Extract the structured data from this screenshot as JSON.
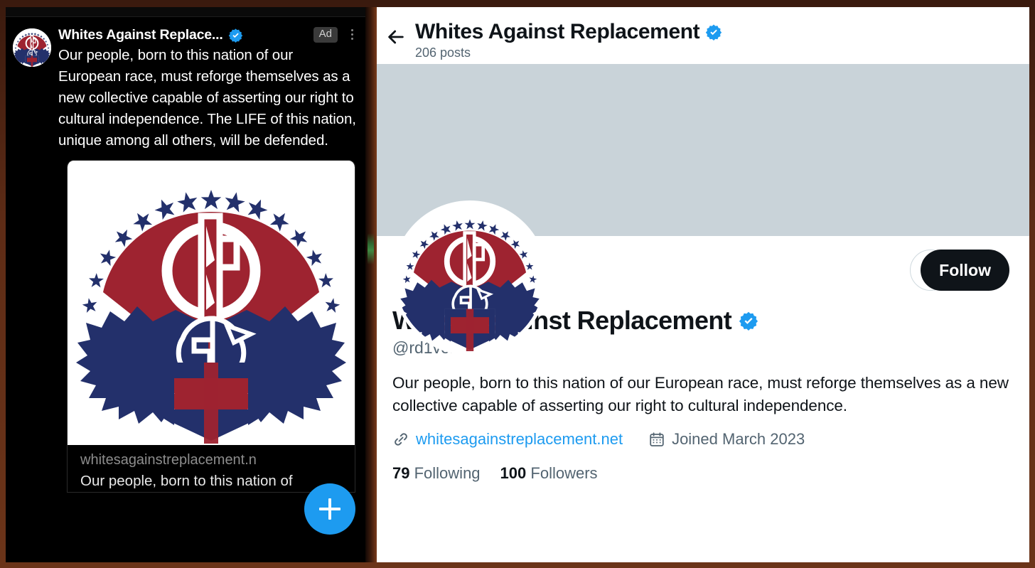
{
  "theme": {
    "frame_color": "#5e2c16",
    "dark_bg": "#000000",
    "accent_blue": "#1d9bf0",
    "banner_color": "#c9d3d9",
    "muted_text": "#536471",
    "scrollbar_green": "#3f8a42"
  },
  "left_ad": {
    "avatar_icon": "emblem-avatar",
    "account_name": "Whites Against Replace...",
    "verified_icon": "verified-badge-icon",
    "ad_label": "Ad",
    "more_icon": "kebab-menu-icon",
    "post_text": "Our people, born to this nation of our European race, must reforge themselves as a new collective capable of asserting our right to cultural independence. The LIFE of this nation, unique among all others, will be defended.",
    "card": {
      "image_icon": "emblem-logo-image",
      "domain": "whitesagainstreplacement.n",
      "description": "Our people, born to this nation of"
    },
    "fab_icon": "plus-icon"
  },
  "profile": {
    "back_icon": "back-arrow-icon",
    "header_title": "Whites Against Replacement",
    "header_verified_icon": "verified-badge-icon",
    "posts_count": "206 posts",
    "banner_icon": "profile-banner",
    "avatar_icon": "emblem-avatar-large",
    "more_options_icon": "more-options-icon",
    "follow_label": "Follow",
    "display_name": "Whites Against Replacement",
    "name_verified_icon": "verified-badge-icon",
    "handle": "@rd1vonn",
    "bio": "Our people, born to this nation of our European race, must reforge themselves as a new collective capable of asserting our right to cultural independence.",
    "link_icon": "link-chain-icon",
    "website": "whitesagainstreplacement.net",
    "calendar_icon": "calendar-icon",
    "joined": "Joined March 2023",
    "stats": {
      "following_count": "79",
      "following_label": "Following",
      "followers_count": "100",
      "followers_label": "Followers"
    }
  }
}
